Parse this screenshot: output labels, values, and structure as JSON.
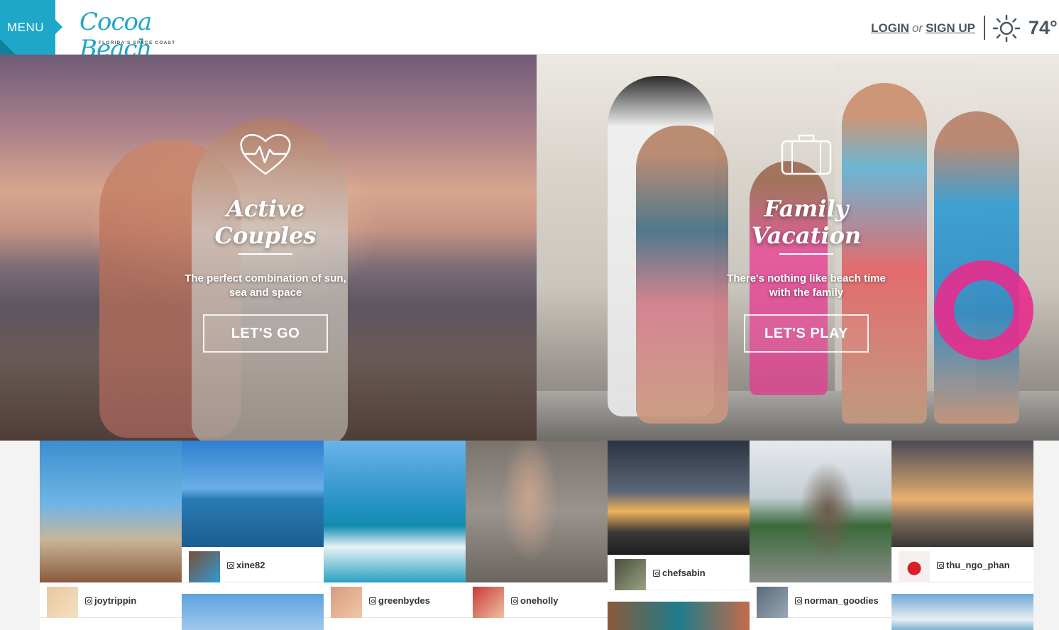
{
  "header": {
    "menu_label": "MENU",
    "logo_name": "Cocoa Beach",
    "logo_tagline": "FLORIDA'S SPACE COAST",
    "login_label": "LOGIN",
    "or_label": "or",
    "signup_label": "SIGN UP",
    "temperature": "74°",
    "weather_icon": "sun-icon"
  },
  "hero": {
    "left": {
      "icon": "heart-pulse-icon",
      "title": "Active Couples",
      "subtitle_line1": "The perfect combination of sun,",
      "subtitle_line2": "sea and space",
      "button_label": "LET'S GO"
    },
    "right": {
      "icon": "suitcase-icon",
      "title": "Family Vacation",
      "subtitle_line1": "There's nothing like beach time",
      "subtitle_line2": "with the family",
      "button_label": "LET'S PLAY"
    }
  },
  "social": {
    "posts": [
      {
        "handle": "joytrippin"
      },
      {
        "handle": "xine82"
      },
      {
        "handle": "greenbydes"
      },
      {
        "handle": "oneholly"
      },
      {
        "handle": "chefsabin"
      },
      {
        "handle": "norman_goodies"
      },
      {
        "handle": "thu_ngo_phan"
      }
    ]
  },
  "colors": {
    "brand": "#1ea7c9",
    "text_dark": "#4a5660"
  }
}
